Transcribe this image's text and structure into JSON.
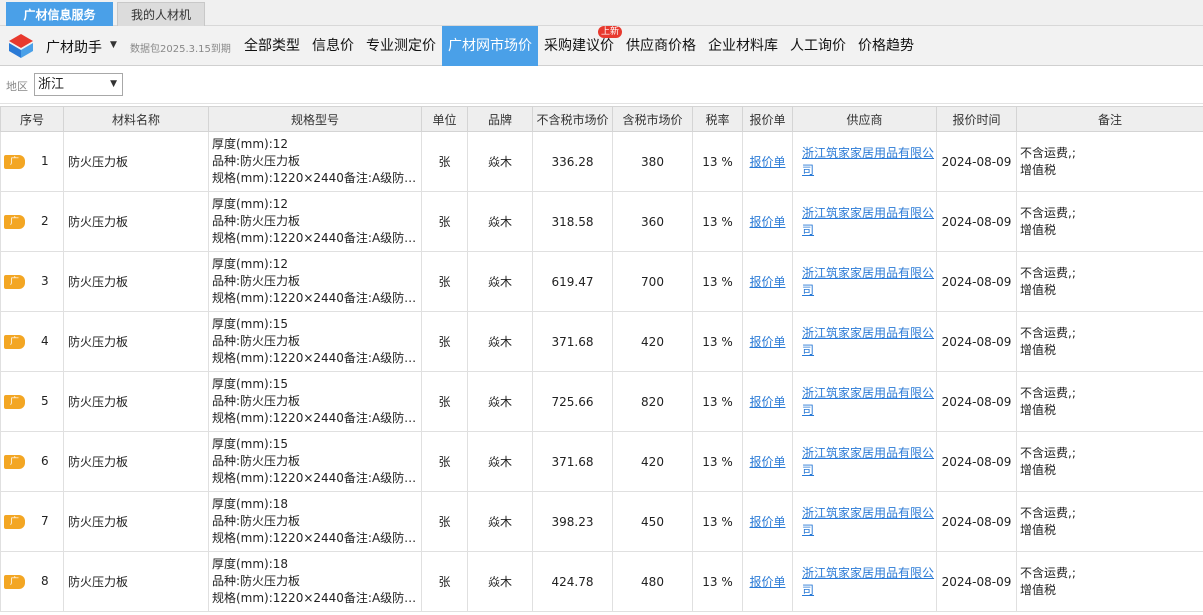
{
  "tabs": {
    "active": "广材信息服务",
    "other": "我的人材机"
  },
  "toolbar": {
    "app_name": "广材助手",
    "data_note": "数据包2025.3.15到期",
    "menu": [
      "全部类型",
      "信息价",
      "专业测定价",
      "广材网市场价",
      "采购建议价",
      "供应商价格",
      "企业材料库",
      "人工询价",
      "价格趋势"
    ],
    "active_index": 3,
    "badge": "上新"
  },
  "filter": {
    "label": "地区",
    "region": "浙江"
  },
  "table": {
    "headers": [
      "序号",
      "材料名称",
      "规格型号",
      "单位",
      "品牌",
      "不含税市场价",
      "含税市场价",
      "税率",
      "报价单",
      "供应商",
      "报价时间",
      "备注"
    ],
    "flag": "广",
    "rows": [
      {
        "no": "1",
        "name": "防火压力板",
        "spec": [
          "厚度(mm):12",
          "品种:防火压力板",
          "规格(mm):1220×2440备注:A级防火..."
        ],
        "unit": "张",
        "brand": "焱木",
        "ex_tax": "336.28",
        "inc_tax": "380",
        "rate": "13 %",
        "quote": "报价单",
        "supplier": "浙江筑家家居用品有限公司",
        "date": "2024-08-09",
        "note1": "不含运费,;",
        "note2": "增值税"
      },
      {
        "no": "2",
        "name": "防火压力板",
        "spec": [
          "厚度(mm):12",
          "品种:防火压力板",
          "规格(mm):1220×2440备注:A级防火..."
        ],
        "unit": "张",
        "brand": "焱木",
        "ex_tax": "318.58",
        "inc_tax": "360",
        "rate": "13 %",
        "quote": "报价单",
        "supplier": "浙江筑家家居用品有限公司",
        "date": "2024-08-09",
        "note1": "不含运费,;",
        "note2": "增值税"
      },
      {
        "no": "3",
        "name": "防火压力板",
        "spec": [
          "厚度(mm):12",
          "品种:防火压力板",
          "规格(mm):1220×2440备注:A级防火..."
        ],
        "unit": "张",
        "brand": "焱木",
        "ex_tax": "619.47",
        "inc_tax": "700",
        "rate": "13 %",
        "quote": "报价单",
        "supplier": "浙江筑家家居用品有限公司",
        "date": "2024-08-09",
        "note1": "不含运费,;",
        "note2": "增值税"
      },
      {
        "no": "4",
        "name": "防火压力板",
        "spec": [
          "厚度(mm):15",
          "品种:防火压力板",
          "规格(mm):1220×2440备注:A级防火..."
        ],
        "unit": "张",
        "brand": "焱木",
        "ex_tax": "371.68",
        "inc_tax": "420",
        "rate": "13 %",
        "quote": "报价单",
        "supplier": "浙江筑家家居用品有限公司",
        "date": "2024-08-09",
        "note1": "不含运费,;",
        "note2": "增值税"
      },
      {
        "no": "5",
        "name": "防火压力板",
        "spec": [
          "厚度(mm):15",
          "品种:防火压力板",
          "规格(mm):1220×2440备注:A级防火..."
        ],
        "unit": "张",
        "brand": "焱木",
        "ex_tax": "725.66",
        "inc_tax": "820",
        "rate": "13 %",
        "quote": "报价单",
        "supplier": "浙江筑家家居用品有限公司",
        "date": "2024-08-09",
        "note1": "不含运费,;",
        "note2": "增值税"
      },
      {
        "no": "6",
        "name": "防火压力板",
        "spec": [
          "厚度(mm):15",
          "品种:防火压力板",
          "规格(mm):1220×2440备注:A级防火..."
        ],
        "unit": "张",
        "brand": "焱木",
        "ex_tax": "371.68",
        "inc_tax": "420",
        "rate": "13 %",
        "quote": "报价单",
        "supplier": "浙江筑家家居用品有限公司",
        "date": "2024-08-09",
        "note1": "不含运费,;",
        "note2": "增值税"
      },
      {
        "no": "7",
        "name": "防火压力板",
        "spec": [
          "厚度(mm):18",
          "品种:防火压力板",
          "规格(mm):1220×2440备注:A级防火..."
        ],
        "unit": "张",
        "brand": "焱木",
        "ex_tax": "398.23",
        "inc_tax": "450",
        "rate": "13 %",
        "quote": "报价单",
        "supplier": "浙江筑家家居用品有限公司",
        "date": "2024-08-09",
        "note1": "不含运费,;",
        "note2": "增值税"
      },
      {
        "no": "8",
        "name": "防火压力板",
        "spec": [
          "厚度(mm):18",
          "品种:防火压力板",
          "规格(mm):1220×2440备注:A级防火..."
        ],
        "unit": "张",
        "brand": "焱木",
        "ex_tax": "424.78",
        "inc_tax": "480",
        "rate": "13 %",
        "quote": "报价单",
        "supplier": "浙江筑家家居用品有限公司",
        "date": "2024-08-09",
        "note1": "不含运费,;",
        "note2": "增值税"
      }
    ]
  },
  "colors": {
    "accent": "#4aa0e8",
    "badge": "#e8392e",
    "flag": "#f3a623",
    "link": "#2a7ad6"
  }
}
